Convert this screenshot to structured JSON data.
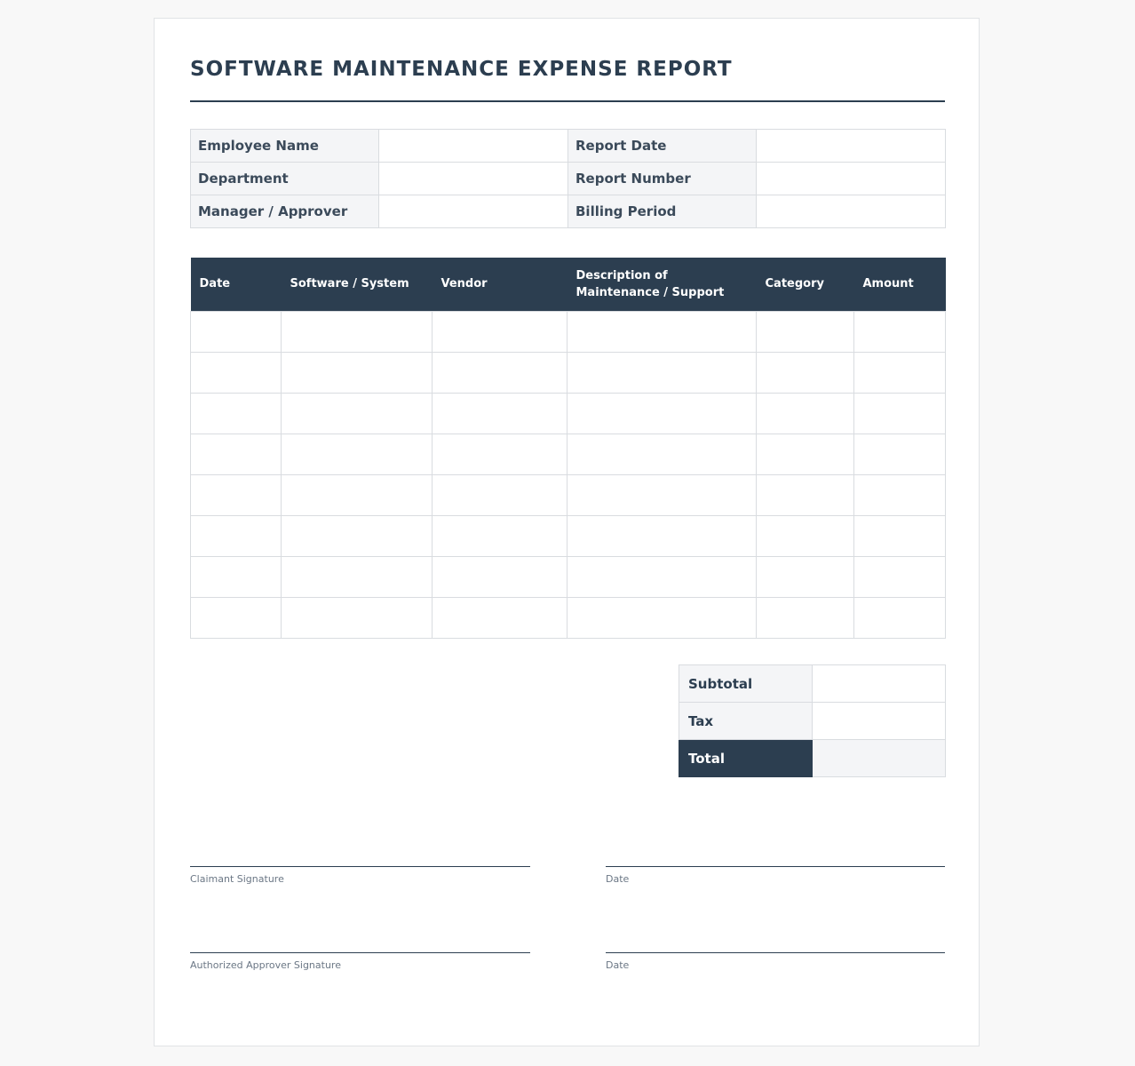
{
  "title": "SOFTWARE MAINTENANCE EXPENSE REPORT",
  "info": {
    "rows": [
      {
        "left_label": "Employee Name",
        "left_value": "",
        "right_label": "Report Date",
        "right_value": ""
      },
      {
        "left_label": "Department",
        "left_value": "",
        "right_label": "Report Number",
        "right_value": ""
      },
      {
        "left_label": "Manager / Approver",
        "left_value": "",
        "right_label": "Billing Period",
        "right_value": ""
      }
    ]
  },
  "expenses": {
    "columns": [
      "Date",
      "Software / System",
      "Vendor",
      "Description of Maintenance / Support",
      "Category",
      "Amount"
    ],
    "row_count": 8
  },
  "totals": {
    "subtotal_label": "Subtotal",
    "subtotal_value": "",
    "tax_label": "Tax",
    "tax_value": "",
    "total_label": "Total",
    "total_value": ""
  },
  "signatures": {
    "claimant": "Claimant Signature",
    "claimant_date": "Date",
    "approver": "Authorized Approver Signature",
    "approver_date": "Date"
  },
  "colors": {
    "primary": "#2c3e50",
    "label_bg": "#f4f5f7",
    "border": "#d9dce0"
  }
}
